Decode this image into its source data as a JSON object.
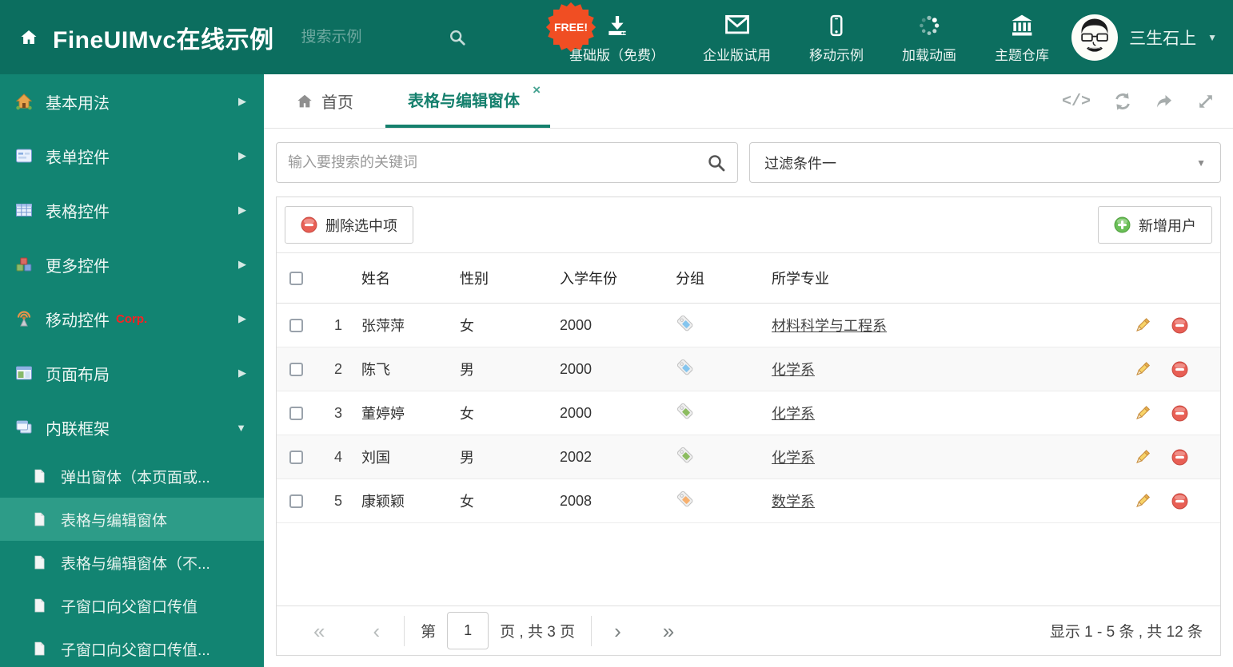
{
  "header": {
    "brand": "FineUIMvc在线示例",
    "search_placeholder": "搜索示例",
    "free_badge": "FREE!",
    "nav_items": [
      {
        "label": "基础版（免费）",
        "icon": "download-icon"
      },
      {
        "label": "企业版试用",
        "icon": "envelope-icon"
      },
      {
        "label": "移动示例",
        "icon": "mobile-icon"
      },
      {
        "label": "加载动画",
        "icon": "spinner-icon"
      },
      {
        "label": "主题仓库",
        "icon": "bank-icon"
      }
    ],
    "user_name": "三生石上"
  },
  "sidebar": {
    "items": [
      {
        "label": "基本用法",
        "icon": "home-icon"
      },
      {
        "label": "表单控件",
        "icon": "form-icon"
      },
      {
        "label": "表格控件",
        "icon": "table-icon"
      },
      {
        "label": "更多控件",
        "icon": "cubes-icon"
      },
      {
        "label": "移动控件",
        "badge": "Corp.",
        "icon": "antenna-icon"
      },
      {
        "label": "页面布局",
        "icon": "layout-icon"
      },
      {
        "label": "内联框架",
        "icon": "frames-icon",
        "expanded": true
      }
    ],
    "subitems": [
      {
        "label": "弹出窗体（本页面或..."
      },
      {
        "label": "表格与编辑窗体",
        "selected": true
      },
      {
        "label": "表格与编辑窗体（不..."
      },
      {
        "label": "子窗口向父窗口传值"
      },
      {
        "label": "子窗口向父窗口传值..."
      }
    ]
  },
  "tabs": {
    "home": "首页",
    "active": "表格与编辑窗体",
    "close_glyph": "×"
  },
  "filters": {
    "search_placeholder": "输入要搜索的关键词",
    "filter_value": "过滤条件一"
  },
  "toolbar": {
    "delete_label": "删除选中项",
    "add_label": "新增用户"
  },
  "table": {
    "columns": {
      "name": "姓名",
      "gender": "性别",
      "year": "入学年份",
      "group": "分组",
      "major": "所学专业"
    },
    "rows": [
      {
        "index": "1",
        "name": "张萍萍",
        "gender": "女",
        "year": "2000",
        "tag": "blue",
        "major": "材料科学与工程系"
      },
      {
        "index": "2",
        "name": "陈飞",
        "gender": "男",
        "year": "2000",
        "tag": "blue",
        "major": "化学系"
      },
      {
        "index": "3",
        "name": "董婷婷",
        "gender": "女",
        "year": "2000",
        "tag": "green",
        "major": "化学系"
      },
      {
        "index": "4",
        "name": "刘国",
        "gender": "男",
        "year": "2002",
        "tag": "green",
        "major": "化学系"
      },
      {
        "index": "5",
        "name": "康颖颖",
        "gender": "女",
        "year": "2008",
        "tag": "orange",
        "major": "数学系"
      }
    ]
  },
  "pagination": {
    "prefix": "第",
    "page": "1",
    "suffix": "页 , 共 3 页",
    "first": "«",
    "prev": "‹",
    "next": "›",
    "last": "»",
    "summary": "显示 1 - 5 条 , 共 12 条"
  },
  "icons": {
    "search": "magnifier",
    "close": "×",
    "chevron_right": "▶",
    "chevron_down": "▼",
    "edit": "yellow-pencil",
    "delete": "red-minus-circle",
    "add": "green-plus-circle",
    "tag": "colored-label-tag",
    "code": "</>",
    "refresh": "circular-arrows",
    "share": "curved-arrow",
    "expand": "diagonal-arrows"
  },
  "colors": {
    "header_bg": "#0c6e5f",
    "sidebar_bg": "#128472",
    "sidebar_selected_bg": "#2d9c88",
    "accent_teal": "#15806d",
    "free_badge": "#f04e23",
    "delete_red": "#e85f55",
    "add_green": "#6abf57",
    "tag_blue": "#85c5ee",
    "tag_green": "#8cbc60",
    "tag_orange": "#f7b06e"
  }
}
